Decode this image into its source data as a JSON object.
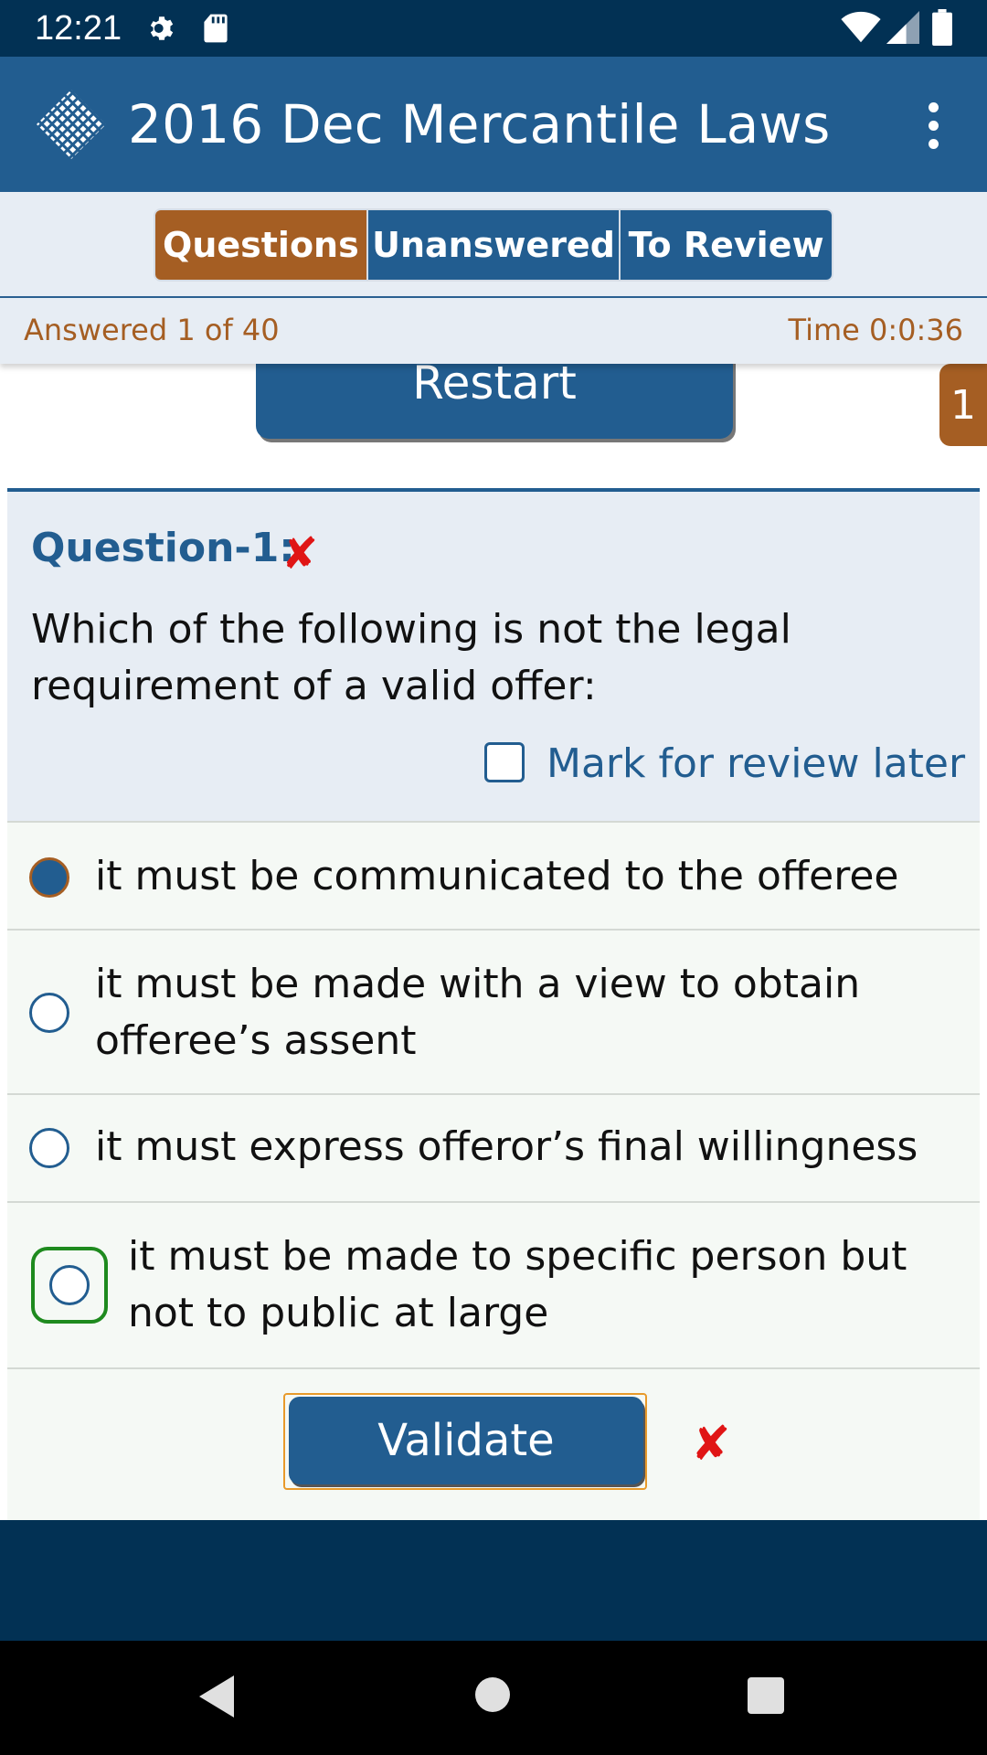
{
  "status_bar": {
    "time": "12:21",
    "icons": [
      "gear-icon",
      "sd-card-icon",
      "wifi-icon",
      "cell-signal-icon",
      "battery-icon"
    ]
  },
  "app_bar": {
    "title": "2016 Dec Mercantile Laws",
    "logo_icon": "diamond-grid-logo",
    "menu_icon": "more-vertical-icon"
  },
  "tabs": [
    {
      "label": "Questions",
      "active": true
    },
    {
      "label": "Unanswered",
      "active": false
    },
    {
      "label": "To Review",
      "active": false
    }
  ],
  "progress": {
    "answered_text": "Answered 1 of 40",
    "time_text": "Time 0:0:36"
  },
  "restart_label": "Restart",
  "side_tab_label": "1",
  "question": {
    "heading": "Question-1:",
    "status_icon": "✘",
    "text": "Which of the following is not the legal requirement of a valid offer:",
    "review_label": "Mark for review later",
    "review_checked": false
  },
  "options": [
    {
      "text": "it must be communicated to the offeree",
      "selected": true,
      "correct": false
    },
    {
      "text": "it must be made with a view to obtain offeree’s assent",
      "selected": false,
      "correct": false
    },
    {
      "text": "it must express offeror’s final willingness",
      "selected": false,
      "correct": false
    },
    {
      "text": "it must be made to specific person but not to public at large",
      "selected": false,
      "correct": true
    }
  ],
  "validate": {
    "label": "Validate",
    "result_icon": "✘"
  },
  "colors": {
    "primary": "#225d90",
    "accent": "#a55e23",
    "status_bar": "#023154",
    "wrong": "#e01515",
    "correct": "#1e8a1e"
  }
}
